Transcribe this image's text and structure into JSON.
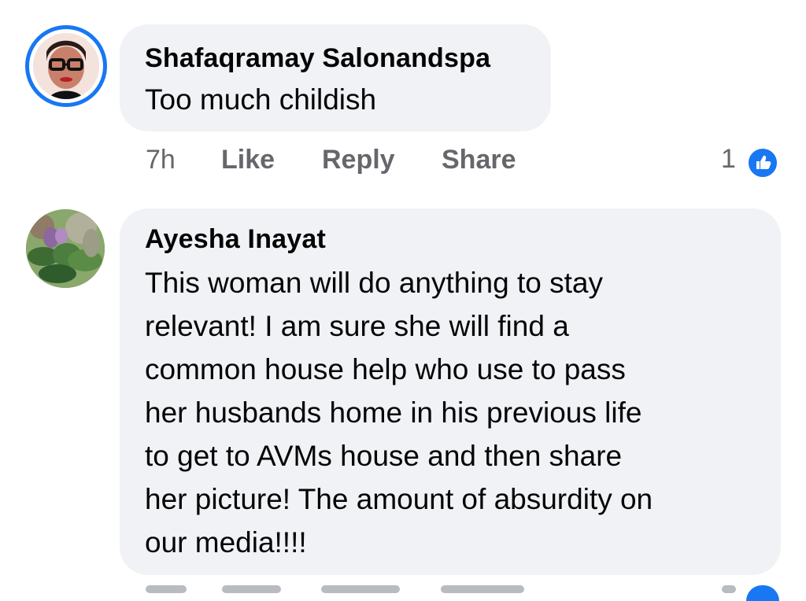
{
  "comments": [
    {
      "author": "Shafaqramay Salonandspa",
      "text": "Too much childish",
      "time": "7h",
      "actions": [
        "Like",
        "Reply",
        "Share"
      ],
      "reaction_count": "1",
      "avatar_icon": "profile-photo-woman-glasses-icon"
    },
    {
      "author": "Ayesha Inayat",
      "text": "This woman will do anything to stay\nrelevant! I am sure she will find a\ncommon house help who use to pass\nher husbands home in his previous life\nto get to AVMs house and then share\nher picture! The amount of absurdity on\nour media!!!!",
      "avatar_icon": "profile-photo-flowers-icon"
    }
  ],
  "colors": {
    "bubble": "#f0f2f5",
    "accent": "#1877f2",
    "secondary_text": "#65676b"
  }
}
